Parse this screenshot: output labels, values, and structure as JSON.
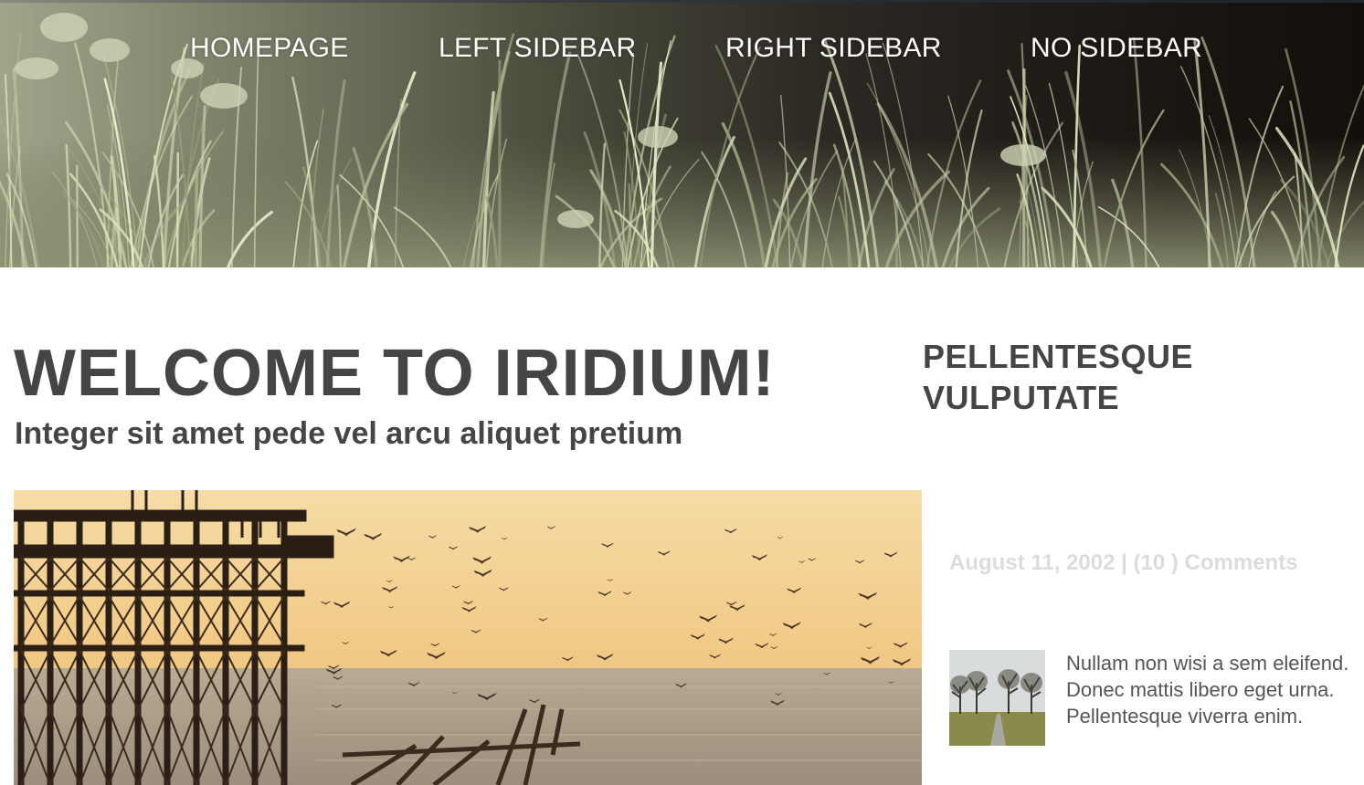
{
  "nav": {
    "items": [
      "HOMEPAGE",
      "LEFT SIDEBAR",
      "RIGHT SIDEBAR",
      "NO SIDEBAR"
    ]
  },
  "main": {
    "title": "WELCOME TO IRIDIUM!",
    "subtitle": "Integer sit amet pede vel arcu aliquet pretium"
  },
  "sidebar": {
    "heading": "PELLENTESQUE VULPUTATE",
    "post": {
      "date": "August 11, 2002",
      "separator": "|",
      "comments_count": "(10 )",
      "comments_label": "Comments",
      "excerpt": "Nullam non wisi a sem eleifend. Donec mattis libero eget urna. Pellentesque viverra enim."
    }
  },
  "colors": {
    "heading": "#454545",
    "meta": "#dcdcdc",
    "nav_text": "#ffffff"
  }
}
